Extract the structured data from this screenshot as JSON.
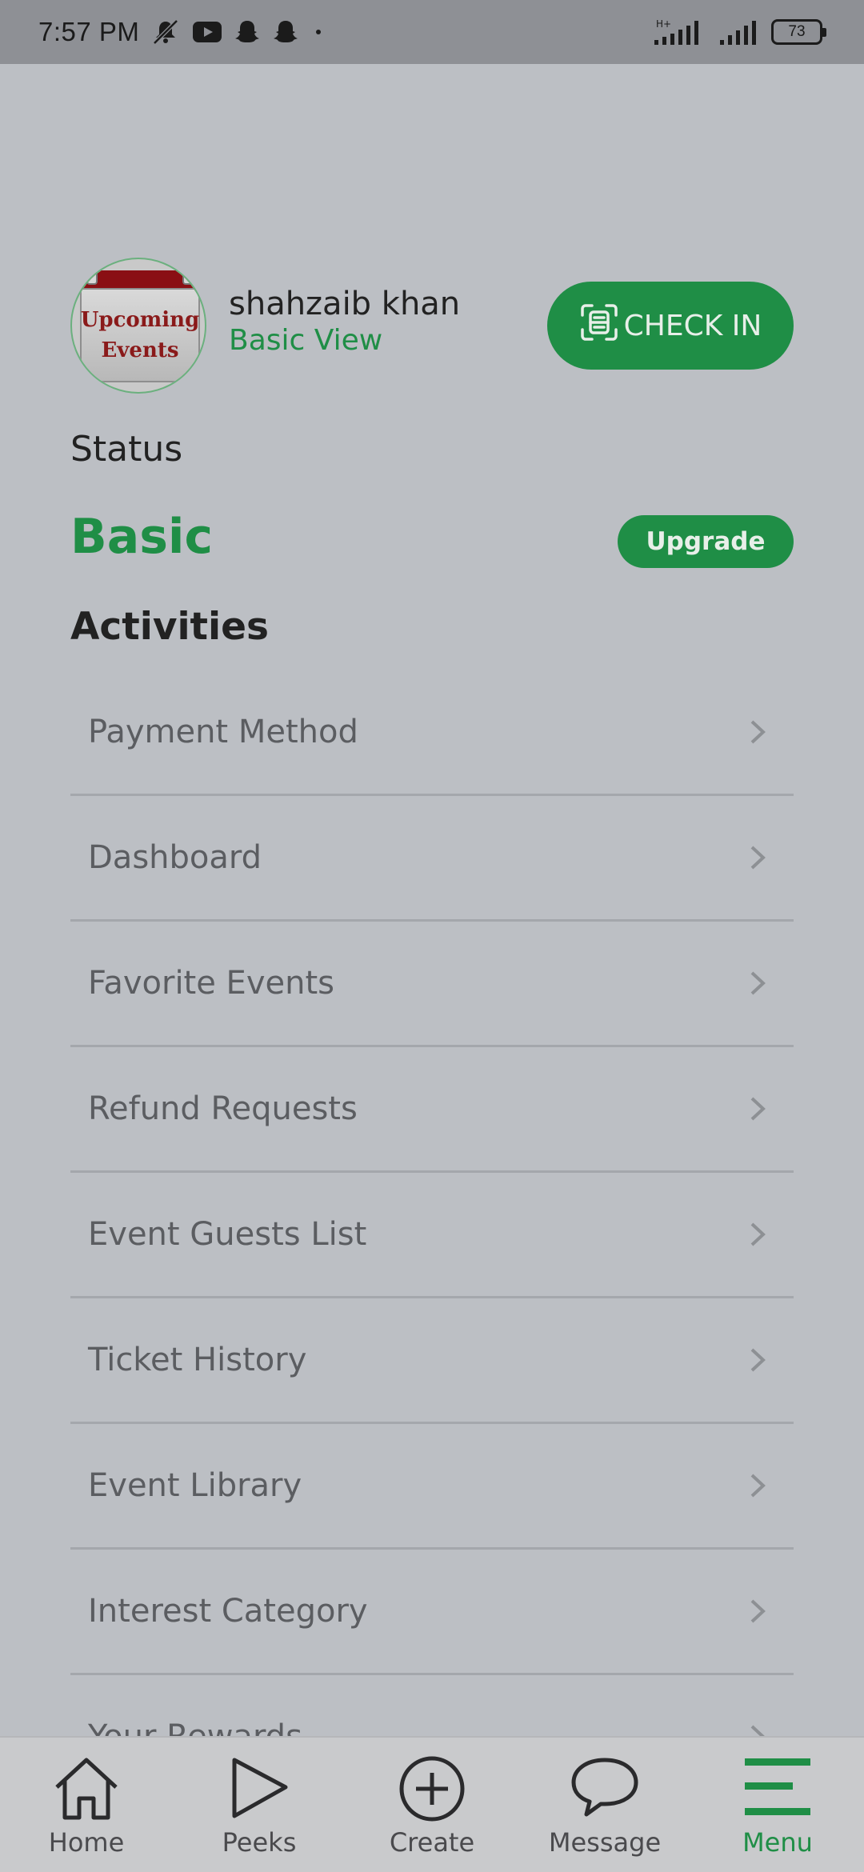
{
  "status_bar": {
    "time": "7:57 PM",
    "battery": "73",
    "network_label": "H+"
  },
  "profile": {
    "avatar_line1": "Upcoming",
    "avatar_line2": "Events",
    "name": "shahzaib khan",
    "view_mode": "Basic View",
    "checkin_label": "CHECK IN"
  },
  "status": {
    "title": "Status",
    "plan": "Basic",
    "upgrade_label": "Upgrade"
  },
  "activities": {
    "title": "Activities",
    "items": [
      {
        "label": "Payment Method"
      },
      {
        "label": "Dashboard"
      },
      {
        "label": "Favorite Events"
      },
      {
        "label": "Refund Requests"
      },
      {
        "label": "Event Guests List"
      },
      {
        "label": "Ticket History"
      },
      {
        "label": "Event Library"
      },
      {
        "label": "Interest Category"
      },
      {
        "label": "Your Rewards"
      }
    ]
  },
  "bottom_nav": {
    "items": [
      {
        "label": "Home",
        "icon": "home-icon"
      },
      {
        "label": "Peeks",
        "icon": "play-icon"
      },
      {
        "label": "Create",
        "icon": "plus-circle-icon"
      },
      {
        "label": "Message",
        "icon": "chat-icon"
      },
      {
        "label": "Menu",
        "icon": "menu-icon",
        "active": true
      }
    ]
  },
  "colors": {
    "accent": "#1f8e46",
    "background": "#bcbfc4",
    "status_bar": "#8e9095"
  }
}
